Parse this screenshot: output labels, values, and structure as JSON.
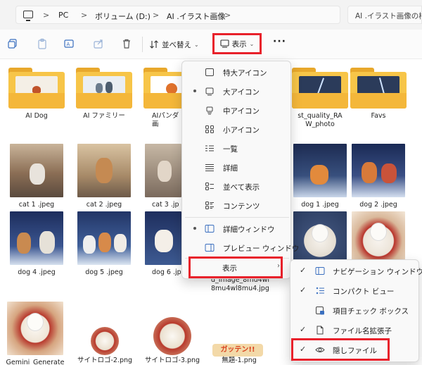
{
  "address_bar": {
    "pc": "PC",
    "drive": "ボリューム (D:)",
    "folder": "AI .イラスト画像",
    "search_placeholder": "AI .イラスト画像の検"
  },
  "toolbar": {
    "sort_label": "並べ替え",
    "view_label": "表示",
    "more_label": "···"
  },
  "files": [
    {
      "name": "AI Dog"
    },
    {
      "name": "AI ファミリー"
    },
    {
      "name": "AIパンダ画"
    },
    {
      "name": "st_quality_RA\nW_photo"
    },
    {
      "name": "Favs"
    },
    {
      "name": "cat 1 .jpeg"
    },
    {
      "name": "cat 2 .jpeg"
    },
    {
      "name": "cat 3 .jp"
    },
    {
      "name": "dog 1 .jpeg"
    },
    {
      "name": "dog 2 .jpeg"
    },
    {
      "name": "dog 4 .jpeg"
    },
    {
      "name": "dog 5 .jpeg"
    },
    {
      "name": "dog 6 .jp"
    },
    {
      "name": "d_Image_8mu4wl\n8mu4wl8mu4.jpg"
    },
    {
      "name": "d_l"
    },
    {
      "name": "Gemini_Generate"
    },
    {
      "name": "サイトロゴ-2.png"
    },
    {
      "name": "サイトロゴ-3.png"
    },
    {
      "name": "無題-1.png"
    }
  ],
  "view_menu": {
    "items": [
      {
        "label": "特大アイコン",
        "selected": false
      },
      {
        "label": "大アイコン",
        "selected": true
      },
      {
        "label": "中アイコン",
        "selected": false
      },
      {
        "label": "小アイコン",
        "selected": false
      },
      {
        "label": "一覧",
        "selected": false
      },
      {
        "label": "詳細",
        "selected": false
      },
      {
        "label": "並べて表示",
        "selected": false
      },
      {
        "label": "コンテンツ",
        "selected": false
      }
    ],
    "pane_items": [
      {
        "label": "詳細ウィンドウ",
        "selected": true
      },
      {
        "label": "プレビュー ウィンドウ",
        "selected": false
      }
    ],
    "show_label": "表示"
  },
  "show_submenu": {
    "items": [
      {
        "label": "ナビゲーション ウィンドウ",
        "checked": true
      },
      {
        "label": "コンパクト ビュー",
        "checked": true
      },
      {
        "label": "項目チェック ボックス",
        "checked": false
      },
      {
        "label": "ファイル名拡張子",
        "checked": true
      },
      {
        "label": "隠しファイル",
        "checked": true
      }
    ]
  },
  "watermark": "ガッテン!!",
  "colors": {
    "highlight": "#e8212b",
    "folder": "#f7c548",
    "menu_bg": "#f9f9f9"
  }
}
